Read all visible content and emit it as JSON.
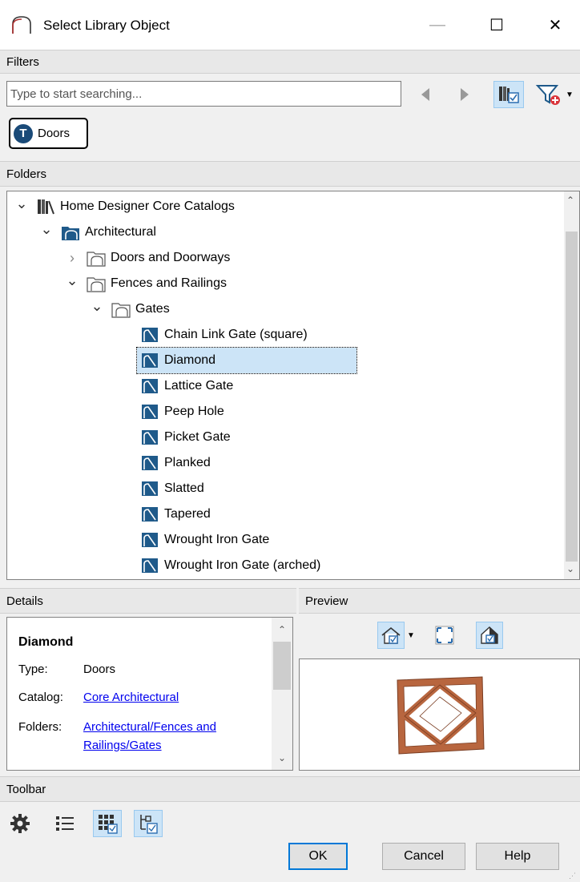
{
  "window": {
    "title": "Select Library Object",
    "minimize": "—",
    "maximize": "☐",
    "close": "✕"
  },
  "filters": {
    "header": "Filters",
    "search_placeholder": "Type to start searching...",
    "chip_letter": "T",
    "chip_label": "Doors"
  },
  "folders": {
    "header": "Folders",
    "items": [
      {
        "label": "Home Designer Core Catalogs",
        "arrow": "expanded",
        "icon": "catalog-books-icon",
        "depth": 0
      },
      {
        "label": "Architectural",
        "arrow": "expanded",
        "icon": "architectural-folder-icon",
        "depth": 1
      },
      {
        "label": "Doors and Doorways",
        "arrow": "collapsed",
        "icon": "folder-outline-icon",
        "depth": 2
      },
      {
        "label": "Fences and Railings",
        "arrow": "expanded",
        "icon": "folder-outline-icon",
        "depth": 2
      },
      {
        "label": "Gates",
        "arrow": "expanded",
        "icon": "folder-outline-icon",
        "depth": 3
      },
      {
        "label": "Chain Link Gate (square)",
        "arrow": "none",
        "icon": "library-item-icon",
        "depth": 4
      },
      {
        "label": "Diamond",
        "arrow": "none",
        "icon": "library-item-icon",
        "depth": 4,
        "selected": true
      },
      {
        "label": "Lattice Gate",
        "arrow": "none",
        "icon": "library-item-icon",
        "depth": 4
      },
      {
        "label": "Peep Hole",
        "arrow": "none",
        "icon": "library-item-icon",
        "depth": 4
      },
      {
        "label": "Picket Gate",
        "arrow": "none",
        "icon": "library-item-icon",
        "depth": 4
      },
      {
        "label": "Planked",
        "arrow": "none",
        "icon": "library-item-icon",
        "depth": 4
      },
      {
        "label": "Slatted",
        "arrow": "none",
        "icon": "library-item-icon",
        "depth": 4
      },
      {
        "label": "Tapered",
        "arrow": "none",
        "icon": "library-item-icon",
        "depth": 4
      },
      {
        "label": "Wrought Iron Gate",
        "arrow": "none",
        "icon": "library-item-icon",
        "depth": 4
      },
      {
        "label": "Wrought Iron Gate (arched)",
        "arrow": "none",
        "icon": "library-item-icon",
        "depth": 4
      }
    ]
  },
  "details": {
    "header": "Details",
    "name": "Diamond",
    "type_label": "Type:",
    "type_value": "Doors",
    "catalog_label": "Catalog:",
    "catalog_value": "Core Architectural",
    "folders_label": "Folders:",
    "folders_line1": "Architectural/Fences and",
    "folders_line2": "Railings/Gates"
  },
  "preview": {
    "header": "Preview"
  },
  "toolbar": {
    "header": "Toolbar"
  },
  "buttons": {
    "ok": "OK",
    "cancel": "Cancel",
    "help": "Help"
  },
  "colors": {
    "accent": "#0078d7",
    "folder_blue": "#1f5a8a",
    "gate_brown": "#b8663f",
    "selection": "#cce4f7"
  }
}
